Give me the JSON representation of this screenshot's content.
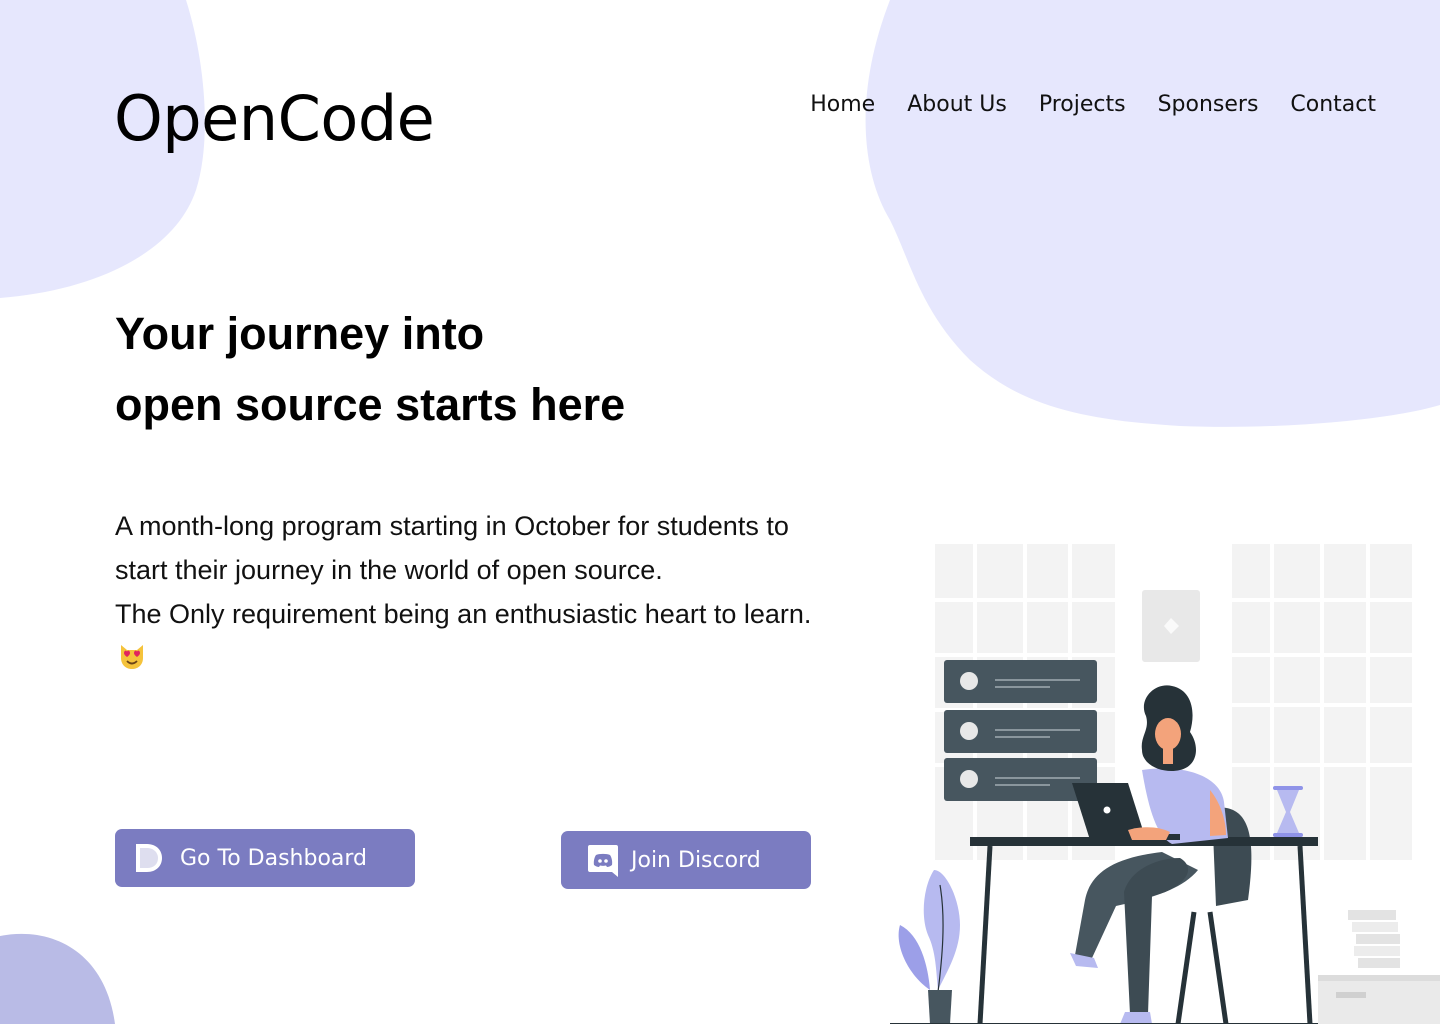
{
  "brand": {
    "name": "OpenCode"
  },
  "nav": {
    "items": [
      "Home",
      "About Us",
      "Projects",
      "Sponsers",
      "Contact"
    ]
  },
  "hero": {
    "headline_line1": "Your journey into",
    "headline_line2": "open source starts here",
    "description_line1": "A month-long program starting in October for students to start their journey in the world of open source.",
    "description_line2": "The Only requirement being an enthusiastic heart to learn.",
    "emoji": "😻"
  },
  "buttons": {
    "dashboard_label": "Go To Dashboard",
    "discord_label": "Join Discord"
  },
  "colors": {
    "accent": "#7b7cc1",
    "blob": "#e6e7fd",
    "blob_dark": "#b9bbe6"
  },
  "icons": [
    "dashboard-logo-icon",
    "discord-icon",
    "cat-heart-eyes-emoji"
  ]
}
